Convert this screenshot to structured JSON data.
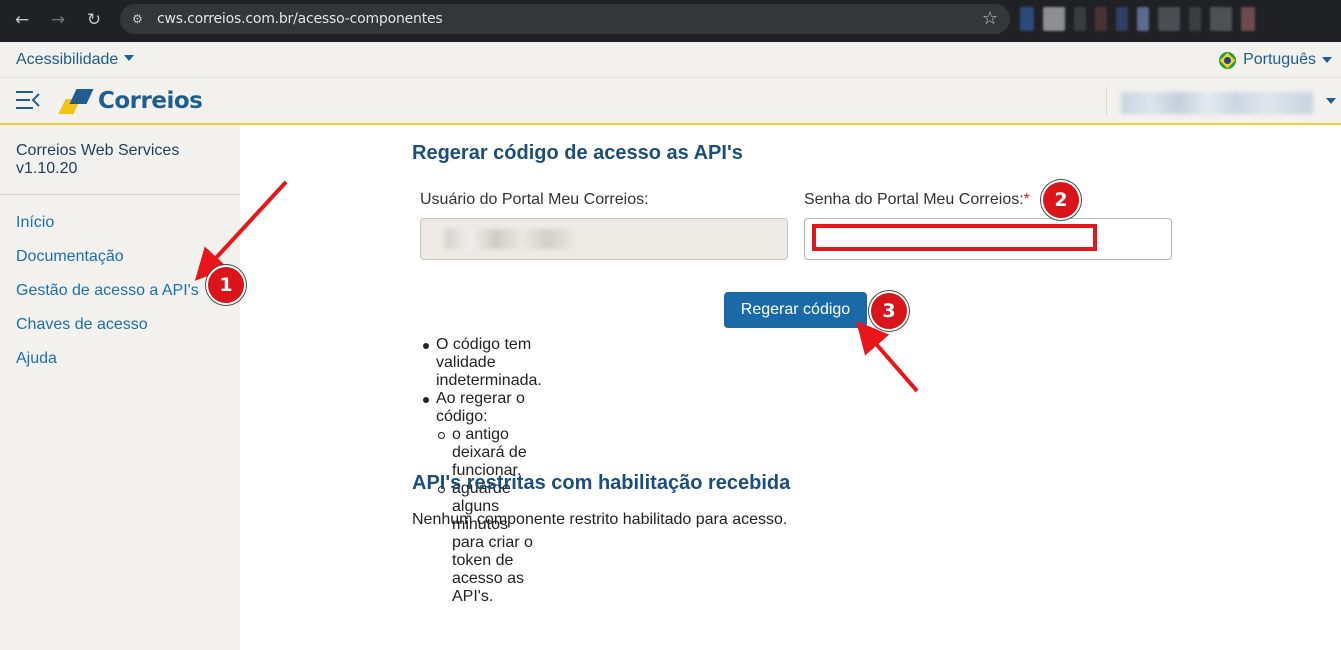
{
  "browser": {
    "back": "←",
    "forward": "→",
    "reload": "↻",
    "site_info": "⚙",
    "url": "cws.correios.com.br/acesso-componentes",
    "star": "☆"
  },
  "topbar": {
    "accessibility_label": "Acessibilidade",
    "language_label": "Português"
  },
  "header": {
    "logo_text": "Correios"
  },
  "sidebar": {
    "app_name": "Correios Web Services",
    "version": "v1.10.20",
    "items": [
      {
        "label": "Início"
      },
      {
        "label": "Documentação"
      },
      {
        "label": "Gestão de acesso a API's"
      },
      {
        "label": "Chaves de acesso"
      },
      {
        "label": "Ajuda"
      }
    ]
  },
  "main": {
    "regen_title": "Regerar código de acesso as API's",
    "user_label": "Usuário do Portal Meu Correios:",
    "password_label": "Senha do Portal Meu Correios:",
    "required_marker": "*",
    "regen_button": "Regerar código",
    "notes": {
      "validity": "O código tem validade indeterminada.",
      "on_regen": "Ao regerar o código:",
      "old_stops": "o antigo deixará de funcionar.",
      "wait": "aguarde alguns minutos para criar o token de acesso as API's."
    },
    "restricted_title": "API's restritas com habilitação recebida",
    "restricted_empty": "Nenhum componente restrito habilitado para acesso."
  },
  "annotations": {
    "step1": "1",
    "step2": "2",
    "step3": "3",
    "color": "#e8151b"
  }
}
